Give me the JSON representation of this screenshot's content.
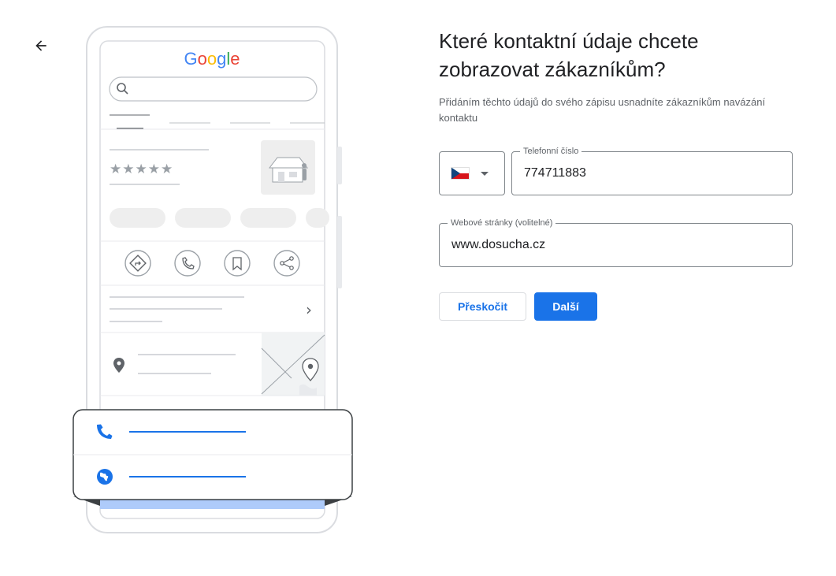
{
  "header": {
    "back_icon": "arrow-back-icon"
  },
  "illustration": {
    "logo_letters": [
      {
        "char": "G",
        "color": "#4285F4"
      },
      {
        "char": "o",
        "color": "#EA4335"
      },
      {
        "char": "o",
        "color": "#FBBC05"
      },
      {
        "char": "g",
        "color": "#4285F4"
      },
      {
        "char": "l",
        "color": "#34A853"
      },
      {
        "char": "e",
        "color": "#EA4335"
      }
    ],
    "rating_stars": "★★★★★",
    "action_icons": [
      "directions-icon",
      "phone-icon",
      "bookmark-icon",
      "share-icon"
    ],
    "chevron": "›",
    "contact_icons": [
      "phone-icon",
      "globe-icon"
    ]
  },
  "main": {
    "title": "Které kontaktní údaje chcete zobrazovat zákazníkům?",
    "subtitle": "Přidáním těchto údajů do svého zápisu usnadníte zákazníkům navázání kontaktu"
  },
  "form": {
    "country": {
      "flag": "CZ",
      "icon": "chevron-down-icon"
    },
    "phone": {
      "label": "Telefonní číslo",
      "value": "774711883"
    },
    "website": {
      "label": "Webové stránky (volitelné)",
      "value": "www.dosucha.cz"
    }
  },
  "actions": {
    "skip_label": "Přeskočit",
    "next_label": "Další"
  },
  "colors": {
    "primary": "#1a73e8",
    "outline": "#80868b",
    "muted_text": "#5f6368"
  }
}
